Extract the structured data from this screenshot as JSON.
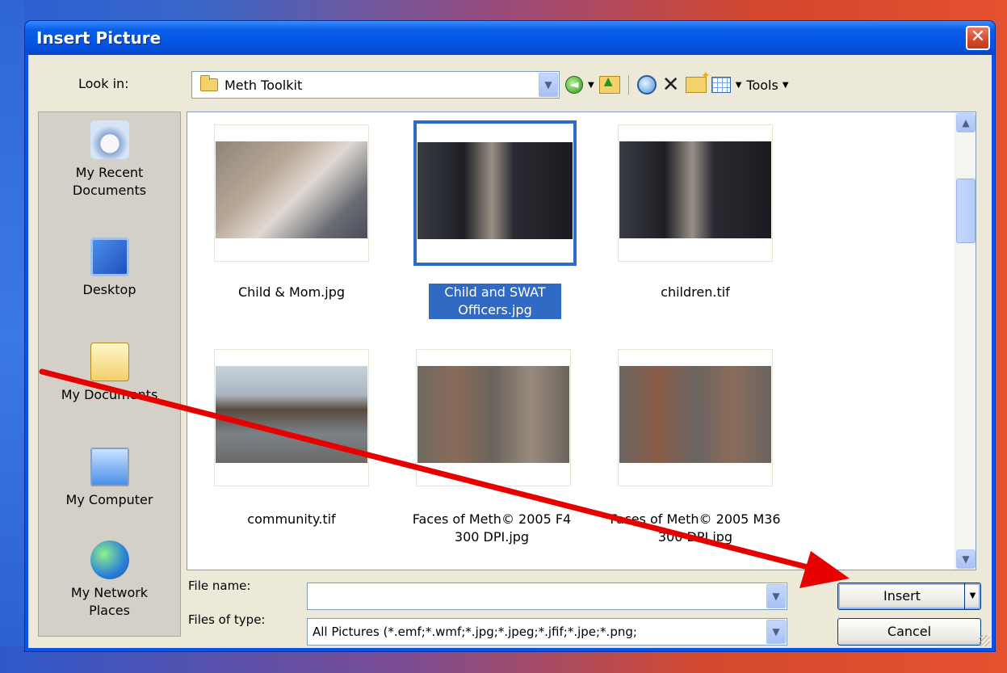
{
  "dialog": {
    "title": "Insert Picture",
    "close_glyph": "✕"
  },
  "lookin": {
    "label": "Look in:",
    "value": "Meth Toolkit"
  },
  "toolbar": {
    "tools_label": "Tools"
  },
  "places": [
    {
      "label": "My Recent Documents",
      "icon": "recent-documents-icon"
    },
    {
      "label": "Desktop",
      "icon": "desktop-icon"
    },
    {
      "label": "My Documents",
      "icon": "my-documents-icon"
    },
    {
      "label": "My Computer",
      "icon": "my-computer-icon"
    },
    {
      "label": "My Network Places",
      "icon": "network-places-icon"
    }
  ],
  "files": [
    {
      "name": "Child & Mom.jpg",
      "selected": false
    },
    {
      "name": "Child and SWAT Officers.jpg",
      "selected": true
    },
    {
      "name": "children.tif",
      "selected": false
    },
    {
      "name": "community.tif",
      "selected": false
    },
    {
      "name": "Faces of Meth© 2005 F4 300 DPI.jpg",
      "selected": false
    },
    {
      "name": "Faces of Meth© 2005 M36 300 DPI.jpg",
      "selected": false
    }
  ],
  "filename": {
    "label": "File name:",
    "value": ""
  },
  "filetype": {
    "label": "Files of type:",
    "value": "All Pictures (*.emf;*.wmf;*.jpg;*.jpeg;*.jfif;*.jpe;*.png;"
  },
  "buttons": {
    "insert": "Insert",
    "cancel": "Cancel"
  },
  "colors": {
    "selection": "#316ac5",
    "titlebar": "#0a5fe8",
    "annotation_arrow": "#e60000"
  }
}
